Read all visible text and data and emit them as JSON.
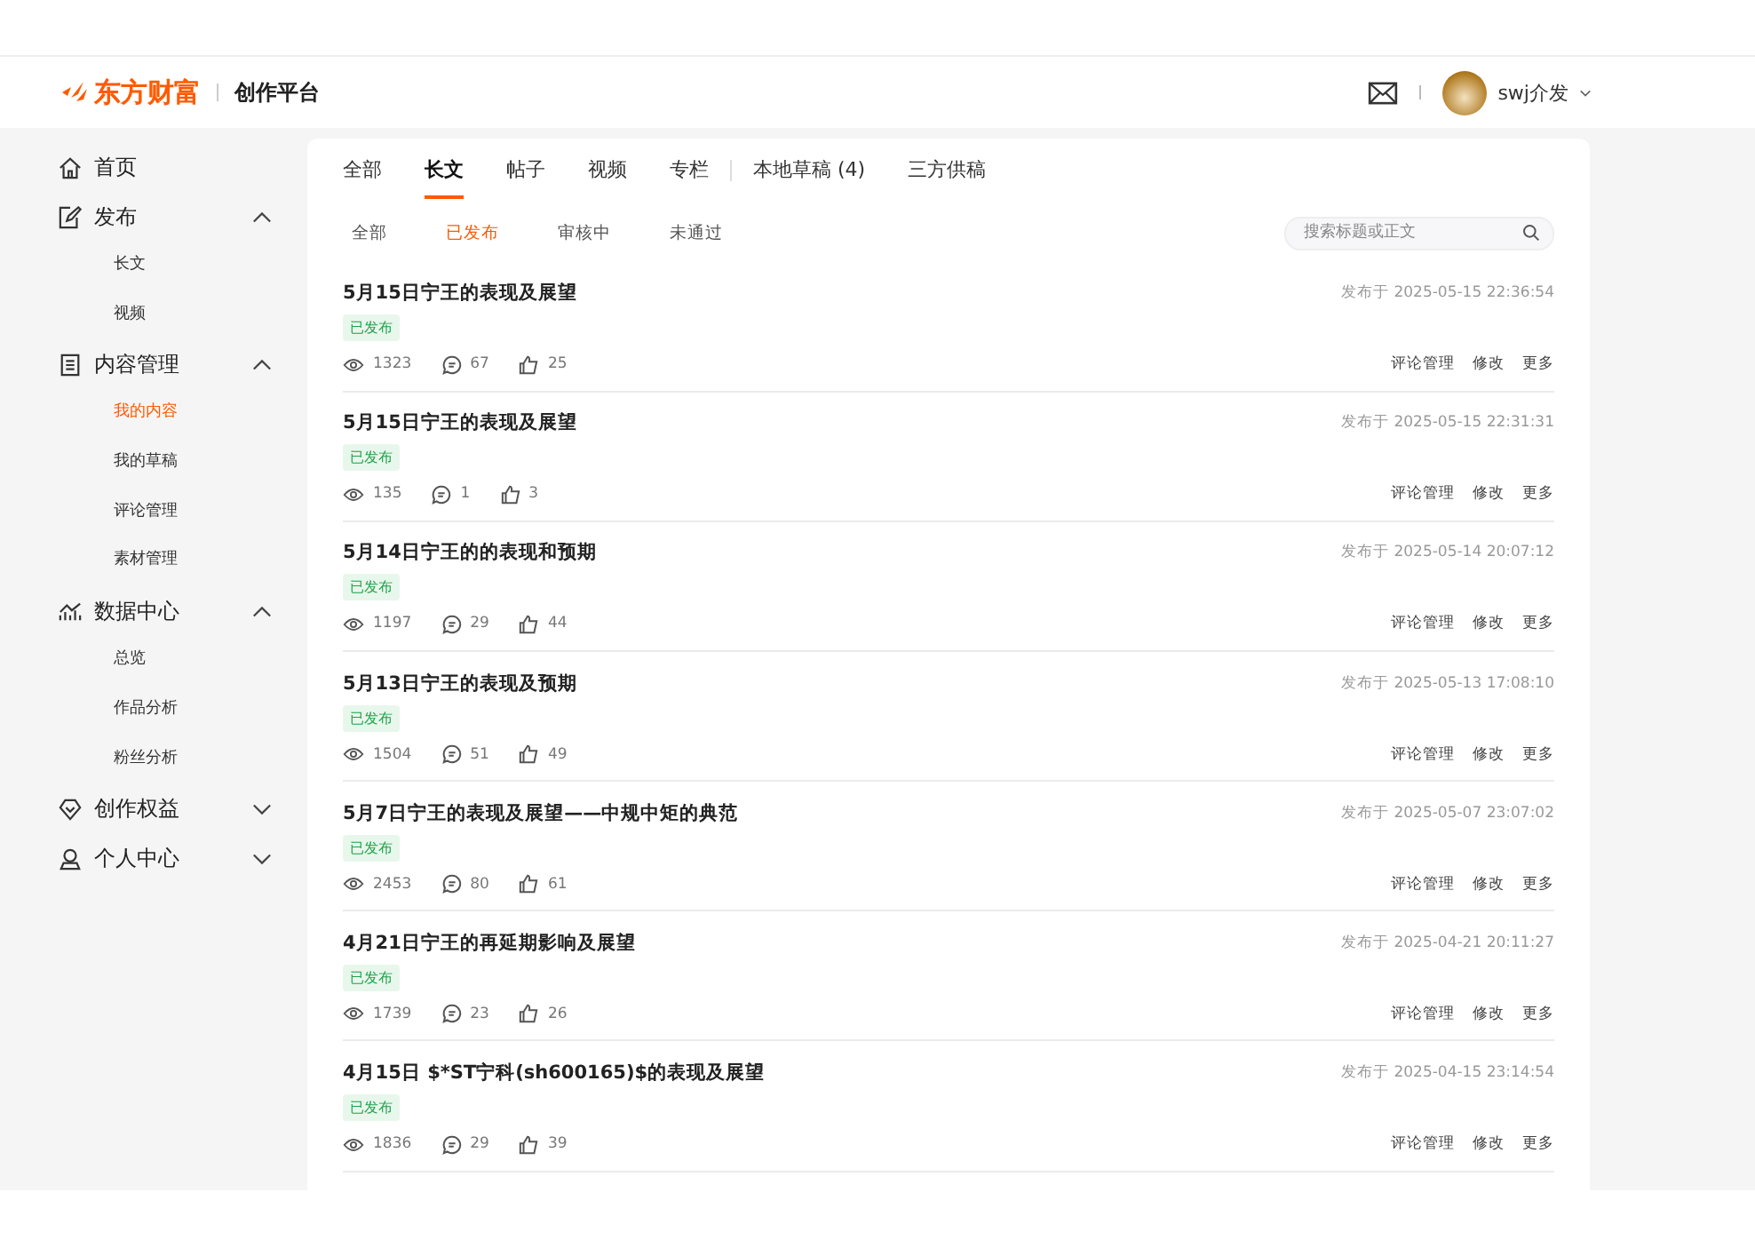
{
  "header": {
    "brand": "东方财富",
    "platform": "创作平台",
    "user": {
      "name": "swj介发"
    }
  },
  "sidebar": {
    "items": [
      {
        "label": "首页"
      },
      {
        "label": "发布",
        "expanded": true,
        "children": [
          {
            "label": "长文",
            "selected": false
          },
          {
            "label": "视频",
            "selected": false
          }
        ]
      },
      {
        "label": "内容管理",
        "expanded": true,
        "children": [
          {
            "label": "我的内容",
            "selected": true
          },
          {
            "label": "我的草稿",
            "selected": false
          },
          {
            "label": "评论管理",
            "selected": false
          },
          {
            "label": "素材管理",
            "selected": false
          }
        ]
      },
      {
        "label": "数据中心",
        "expanded": true,
        "children": [
          {
            "label": "总览",
            "selected": false
          },
          {
            "label": "作品分析",
            "selected": false
          },
          {
            "label": "粉丝分析",
            "selected": false
          }
        ]
      },
      {
        "label": "创作权益",
        "expanded": false
      },
      {
        "label": "个人中心",
        "expanded": false
      }
    ]
  },
  "tabs": [
    {
      "label": "全部",
      "selected": false
    },
    {
      "label": "长文",
      "selected": true
    },
    {
      "label": "帖子",
      "selected": false
    },
    {
      "label": "视频",
      "selected": false
    },
    {
      "label": "专栏",
      "selected": false
    }
  ],
  "extra_tabs": [
    {
      "label": "本地草稿 (4)",
      "selected": false
    },
    {
      "label": "三方供稿",
      "selected": false
    }
  ],
  "sub_tabs": [
    {
      "label": "全部",
      "selected": false
    },
    {
      "label": "已发布",
      "selected": true
    },
    {
      "label": "审核中",
      "selected": false
    },
    {
      "label": "未通过",
      "selected": false
    }
  ],
  "search": {
    "placeholder": "搜索标题或正文"
  },
  "articles": [
    {
      "title": "5月15日宁王的表现及展望",
      "status": "已发布",
      "views": "1323",
      "comments": "67",
      "likes": "25",
      "time": "发布于 2025-05-15 22:36:54",
      "actions": [
        "评论管理",
        "修改",
        "更多"
      ]
    },
    {
      "title": "5月15日宁王的表现及展望",
      "status": "已发布",
      "views": "135",
      "comments": "1",
      "likes": "3",
      "time": "发布于 2025-05-15 22:31:31",
      "actions": [
        "评论管理",
        "修改",
        "更多"
      ]
    },
    {
      "title": "5月14日宁王的的表现和预期",
      "status": "已发布",
      "views": "1197",
      "comments": "29",
      "likes": "44",
      "time": "发布于 2025-05-14 20:07:12",
      "actions": [
        "评论管理",
        "修改",
        "更多"
      ]
    },
    {
      "title": "5月13日宁王的表现及预期",
      "status": "已发布",
      "views": "1504",
      "comments": "51",
      "likes": "49",
      "time": "发布于 2025-05-13 17:08:10",
      "actions": [
        "评论管理",
        "修改",
        "更多"
      ]
    },
    {
      "title": "5月7日宁王的表现及展望——中规中矩的典范",
      "status": "已发布",
      "views": "2453",
      "comments": "80",
      "likes": "61",
      "time": "发布于 2025-05-07 23:07:02",
      "actions": [
        "评论管理",
        "修改",
        "更多"
      ]
    },
    {
      "title": "4月21日宁王的再延期影响及展望",
      "status": "已发布",
      "views": "1739",
      "comments": "23",
      "likes": "26",
      "time": "发布于 2025-04-21 20:11:27",
      "actions": [
        "评论管理",
        "修改",
        "更多"
      ]
    },
    {
      "title": "4月15日 $*ST宁科(sh600165)$的表现及展望",
      "status": "已发布",
      "views": "1836",
      "comments": "29",
      "likes": "39",
      "time": "发布于 2025-04-15 23:14:54",
      "actions": [
        "评论管理",
        "修改",
        "更多"
      ]
    }
  ]
}
